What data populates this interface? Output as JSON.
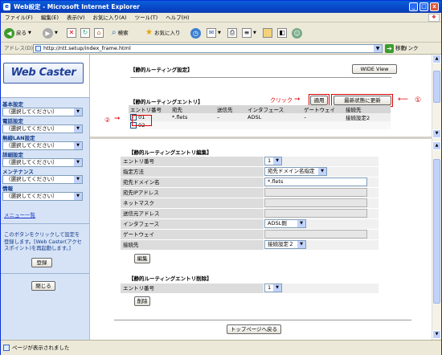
{
  "window": {
    "title": "Web設定 - Microsoft Internet Explorer",
    "min": "_",
    "max": "□",
    "close": "x"
  },
  "menu": [
    "ファイル(F)",
    "編集(E)",
    "表示(V)",
    "お気に入り(A)",
    "ツール(T)",
    "ヘルプ(H)"
  ],
  "toolbar": {
    "back": "戻る",
    "search": "検索",
    "favorites": "お気に入り"
  },
  "address": {
    "label": "アドレス(D)",
    "url": "http://ntt.setup/index_frame.html",
    "go": "移動",
    "links": "リンク"
  },
  "sidebar": {
    "logo": "Web Caster",
    "groups": [
      {
        "label": "基本設定",
        "select": "（選択してください）"
      },
      {
        "label": "電話設定",
        "select": "（選択してください）"
      },
      {
        "label": "無線LAN設定",
        "select": "（選択してください）"
      },
      {
        "label": "詳細設定",
        "select": "（選択してください）"
      },
      {
        "label": "メンテナンス",
        "select": "（選択してください）"
      },
      {
        "label": "情報",
        "select": "（選択してください）"
      }
    ],
    "menu_list": "メニュー一覧",
    "register_msg": "このボタンをクリックして設定を登録します。[Web Caster(アクセスポイント)を再起動します。]",
    "register_button": "登録",
    "close_button": "閉じる"
  },
  "top_pane": {
    "section_title": "【静的ルーティング設定】",
    "wide_view": "WIDE View",
    "entries_title": "【静的ルーティングエントリ】",
    "click_label": "クリック",
    "apply_button": "適用",
    "refresh_button": "最新状態に更新",
    "callout_1": "①",
    "callout_2": "②",
    "columns": [
      "エントリ番号",
      "宛先",
      "送信先",
      "インタフェース",
      "ゲートウェイ",
      "接続先"
    ],
    "rows": [
      {
        "no": "01",
        "dest": "*.flets",
        "via": "–",
        "iface": "ADSL",
        "gw": "–",
        "conn": "接続設定2",
        "checked": true
      },
      {
        "no": "02",
        "dest": "",
        "via": "",
        "iface": "",
        "gw": "",
        "conn": "",
        "checked": false
      }
    ]
  },
  "edit_pane": {
    "title": "【静的ルーティングエントリ編集】",
    "fields": [
      {
        "label": "エントリ番号",
        "type": "select",
        "value": "1",
        "disabled": false
      },
      {
        "label": "指定方法",
        "type": "select",
        "value": "宛先ドメイン名指定",
        "disabled": false
      },
      {
        "label": "宛先ドメイン名",
        "type": "input",
        "value": "*.flets",
        "disabled": false
      },
      {
        "label": "宛先IPアドレス",
        "type": "input",
        "value": "",
        "disabled": true
      },
      {
        "label": "ネットマスク",
        "type": "input",
        "value": "",
        "disabled": true
      },
      {
        "label": "送信元アドレス",
        "type": "input",
        "value": "",
        "disabled": true
      },
      {
        "label": "インタフェース",
        "type": "select",
        "value": "ADSL側",
        "disabled": false
      },
      {
        "label": "ゲートウェイ",
        "type": "input",
        "value": "",
        "disabled": true
      },
      {
        "label": "接続先",
        "type": "select",
        "value": "接続設定２",
        "disabled": false
      }
    ],
    "edit_button": "編集",
    "delete_title": "【静的ルーティングエントリ削除】",
    "delete_field_label": "エントリ番号",
    "delete_field_value": "1",
    "delete_button": "削除",
    "top_button": "トップページへ戻る"
  },
  "status": {
    "text": "ページが表示されました"
  }
}
